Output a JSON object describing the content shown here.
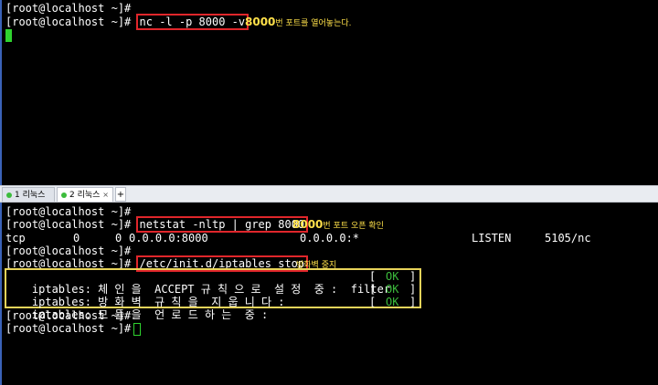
{
  "top": {
    "prompt1": "[root@localhost ~]#",
    "prompt2": "[root@localhost ~]#",
    "cmd": "nc -l -p 8000 -v",
    "note_num": "8000",
    "note_text": "번 포트를 열어놓는다."
  },
  "tabs": [
    {
      "label": "1 리눅스"
    },
    {
      "label": "2 리눅스"
    }
  ],
  "tab_add_label": "+",
  "tab_close_label": "×",
  "bottom": {
    "prompt": "[root@localhost ~]#",
    "cmd_netstat": "netstat -nltp | grep 8000",
    "note1_num": "8000",
    "note1_text": "번 포트 오픈 확인",
    "tcp_row": {
      "proto": "tcp",
      "recvq": "0",
      "sendq": "0",
      "local": "0.0.0.0:8000",
      "foreign": "0.0.0.0:*",
      "state": "LISTEN",
      "pid": "5105/nc"
    },
    "cmd_iptables": "/etc/init.d/iptables stop",
    "note2_text": "방화벽 중지",
    "iptables_lines": [
      {
        "text": "iptables: 체 인 을  ACCEPT 규 칙 으 로  설 정  중 :  filter",
        "status": "OK"
      },
      {
        "text": "iptables: 방 화 벽  규 칙 을  지 웁 니 다 :",
        "status": "OK"
      },
      {
        "text": "iptables: 모 듈 을  언 로 드 하 는  중 :",
        "status": "OK"
      }
    ],
    "bracket_open": "[",
    "bracket_close": "]"
  },
  "colors": {
    "accent_red": "#e0262b",
    "note_yellow": "#ffe14a",
    "ok_green": "#3cbc3c",
    "cursor_green": "#2fd32f"
  }
}
